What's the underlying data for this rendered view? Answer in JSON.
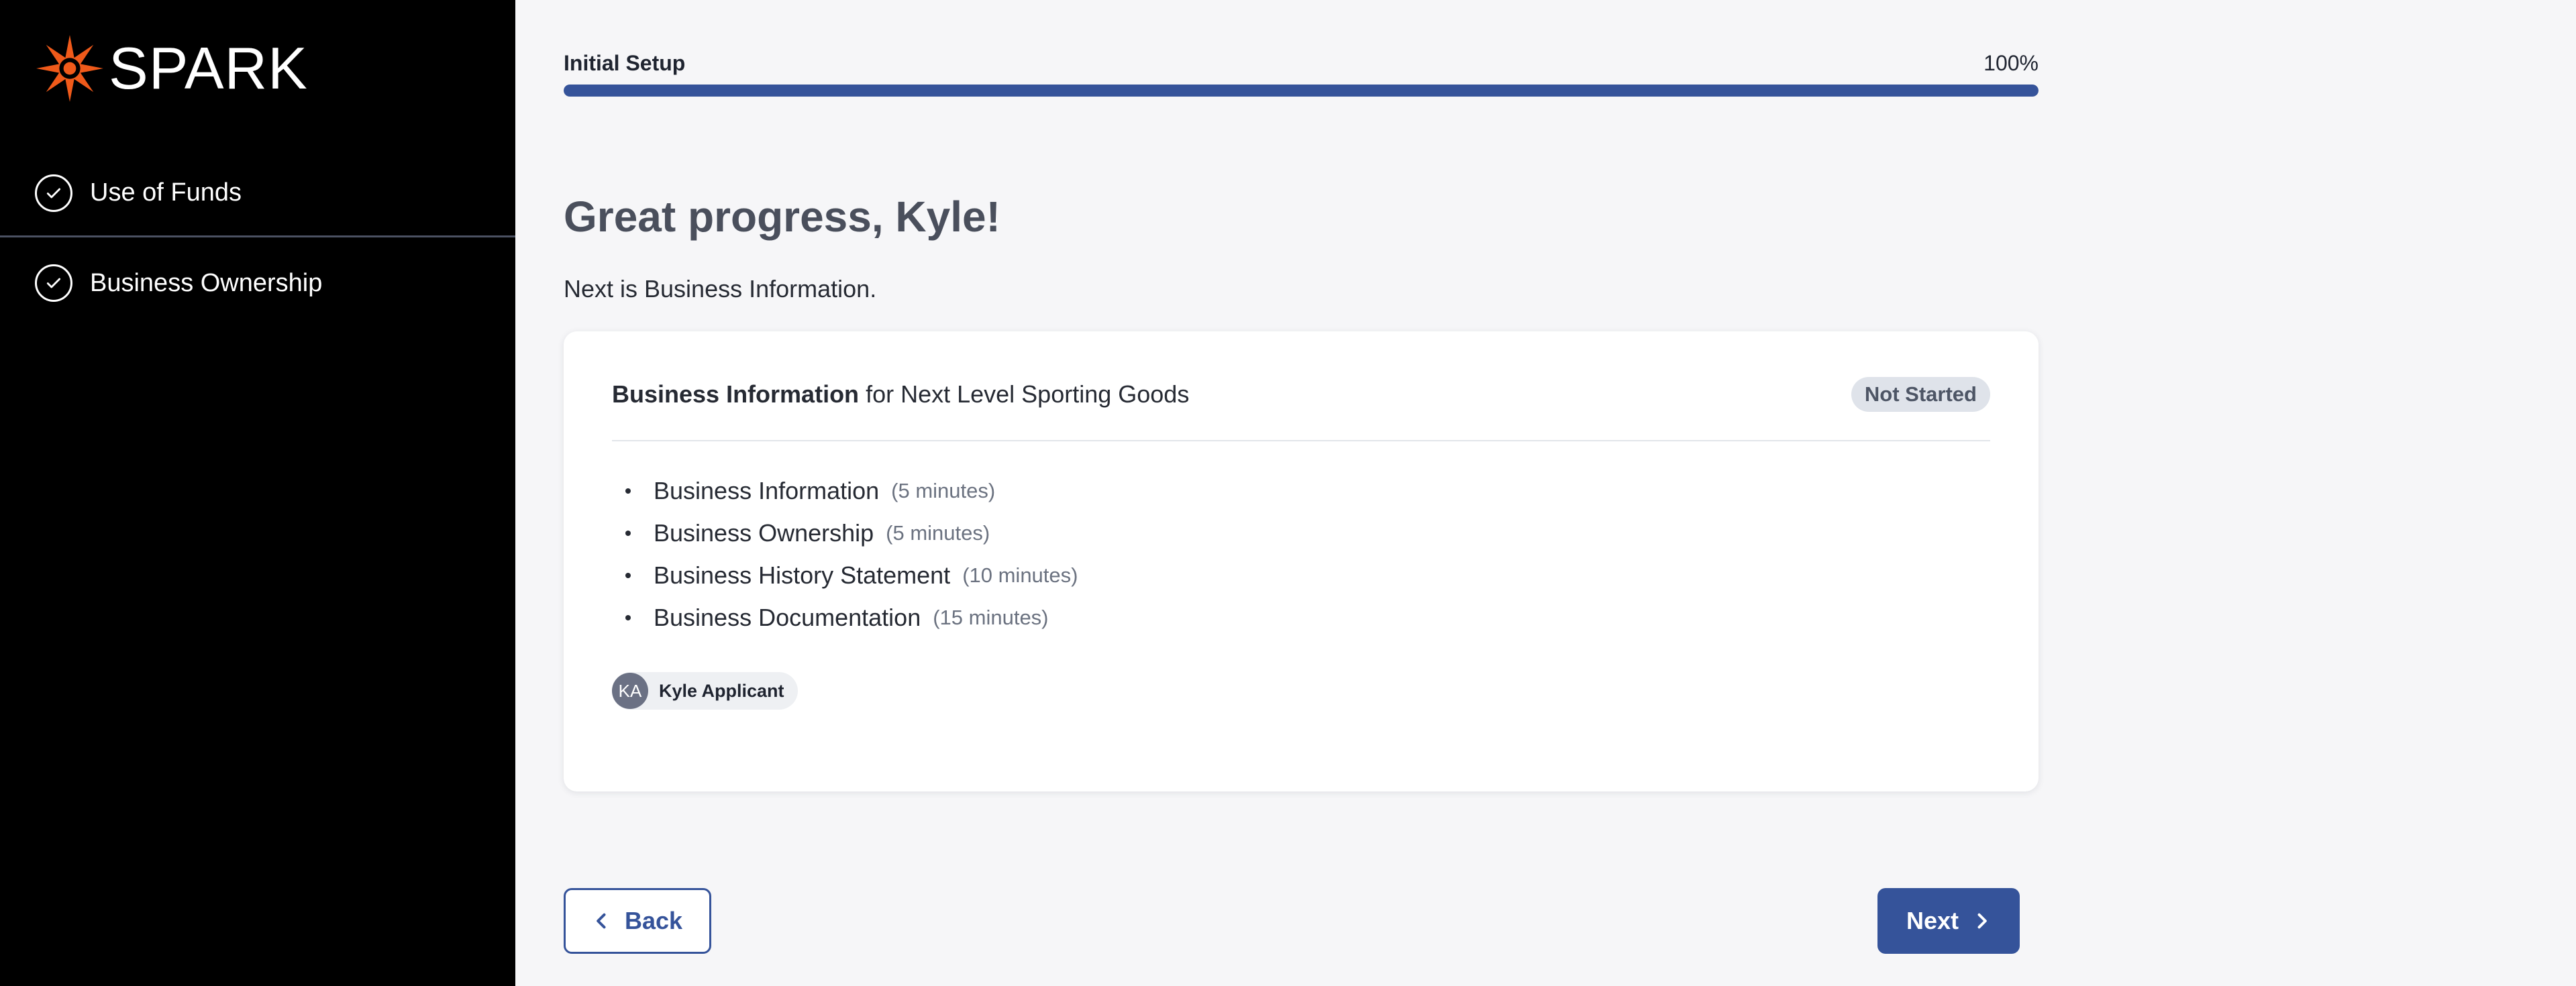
{
  "brand": {
    "name": "SPARK",
    "accent_color": "#f05a1a"
  },
  "sidebar": {
    "items": [
      {
        "label": "Use of Funds",
        "icon": "check-circle-icon",
        "status": "complete"
      },
      {
        "label": "Business Ownership",
        "icon": "check-circle-icon",
        "status": "complete"
      }
    ]
  },
  "progress": {
    "label": "Initial Setup",
    "percent_text": "100%",
    "value": 1.0,
    "color": "#35539a"
  },
  "main": {
    "heading": "Great progress, Kyle!",
    "subheading": "Next is Business Information."
  },
  "card": {
    "title_bold": "Business Information",
    "title_rest": " for Next Level Sporting Goods",
    "status_badge": "Not Started",
    "tasks": [
      {
        "name": "Business Information",
        "duration": "(5 minutes)"
      },
      {
        "name": "Business Ownership",
        "duration": "(5 minutes)"
      },
      {
        "name": "Business History Statement",
        "duration": "(10 minutes)"
      },
      {
        "name": "Business Documentation",
        "duration": "(15 minutes)"
      }
    ],
    "assignee": {
      "initials": "KA",
      "name": "Kyle Applicant"
    }
  },
  "buttons": {
    "back_label": "Back",
    "next_label": "Next"
  }
}
